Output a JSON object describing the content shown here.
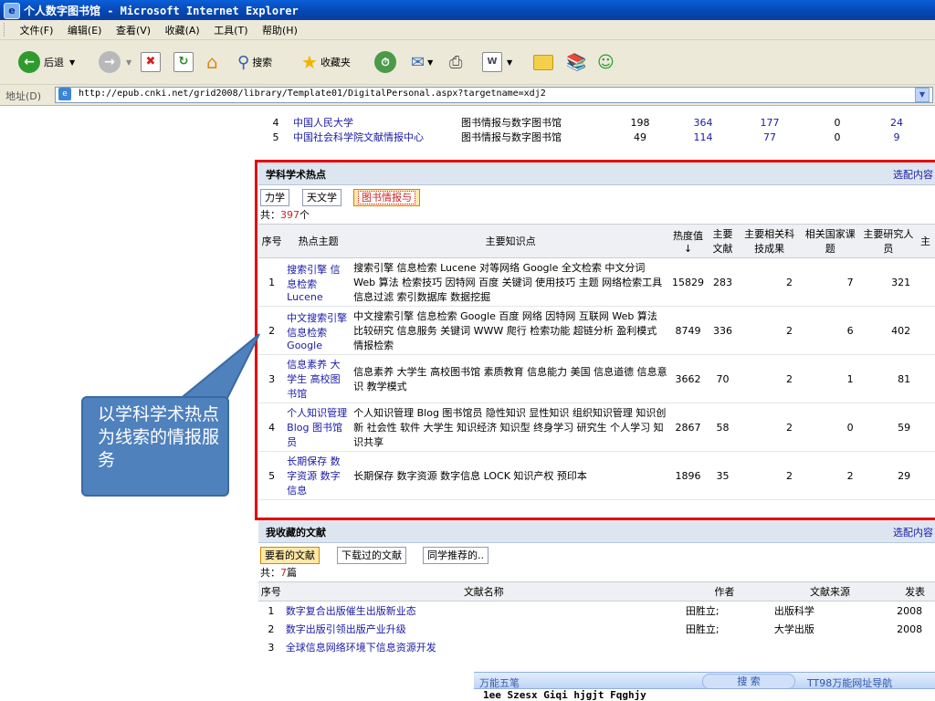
{
  "window": {
    "title": "个人数字图书馆 - Microsoft Internet Explorer"
  },
  "menu": [
    "文件(F)",
    "编辑(E)",
    "查看(V)",
    "收藏(A)",
    "工具(T)",
    "帮助(H)"
  ],
  "toolbar": {
    "back_label": "后退",
    "search_label": "搜索",
    "favorites_label": "收藏夹"
  },
  "address": {
    "label": "地址(D)",
    "url": "http://epub.cnki.net/grid2008/library/Template01/DigitalPersonal.aspx?targetname=xdj2"
  },
  "top_rows": [
    {
      "no": "4",
      "name": "中国人民大学",
      "subject": "图书情报与数字图书馆",
      "c1": "198",
      "c2": "364",
      "c3": "177",
      "c4": "0",
      "c5": "24"
    },
    {
      "no": "5",
      "name": "中国社会科学院文献情报中心",
      "subject": "图书情报与数字图书馆",
      "c1": "49",
      "c2": "114",
      "c3": "77",
      "c4": "0",
      "c5": "9"
    }
  ],
  "hot_panel": {
    "title": "学科学术热点",
    "options_label": "选配内容",
    "tabs": [
      "力学",
      "天文学",
      "图书情报与"
    ],
    "count_prefix": "共：",
    "count_value": "397",
    "count_suffix": "个",
    "headers": [
      "序号",
      "热点主题",
      "主要知识点",
      "热度值↓",
      "主要文献",
      "主要相关科技成果",
      "相关国家课题",
      "主要研究人员",
      "主"
    ],
    "rows": [
      {
        "no": "1",
        "topic": "搜索引擎 信息检索 Lucene",
        "points": "搜索引擎 信息检索 Lucene 对等网络 Google 全文检索 中文分词 Web 算法 检索技巧 因特网 百度 关键词 使用技巧 主题 网络检索工具 信息过滤 索引数据库 数据挖掘",
        "heat": "15829",
        "docs": "283",
        "achv": "2",
        "proj": "7",
        "people": "321"
      },
      {
        "no": "2",
        "topic": "中文搜索引擎 信息检索 Google",
        "points": "中文搜索引擎 信息检索 Google 百度 网络 因特网 互联网 Web 算法 比较研究 信息服务 关键词 WWW 爬行 检索功能 超链分析 盈利模式 情报检索",
        "heat": "8749",
        "docs": "336",
        "achv": "2",
        "proj": "6",
        "people": "402"
      },
      {
        "no": "3",
        "topic": "信息素养 大学生 高校图书馆",
        "points": "信息素养 大学生 高校图书馆 素质教育 信息能力 美国 信息道德 信息意识 教学模式",
        "heat": "3662",
        "docs": "70",
        "achv": "2",
        "proj": "1",
        "people": "81"
      },
      {
        "no": "4",
        "topic": "个人知识管理 Blog 图书馆员",
        "points": "个人知识管理 Blog 图书馆员 隐性知识 显性知识 组织知识管理 知识创新 社会性 软件 大学生 知识经济 知识型 终身学习 研究生 个人学习 知识共享",
        "heat": "2867",
        "docs": "58",
        "achv": "2",
        "proj": "0",
        "people": "59"
      },
      {
        "no": "5",
        "topic": "长期保存 数字资源 数字信息",
        "points": "长期保存 数字资源 数字信息 LOCK 知识产权 预印本",
        "heat": "1896",
        "docs": "35",
        "achv": "2",
        "proj": "2",
        "people": "29"
      }
    ]
  },
  "fav_panel": {
    "title": "我收藏的文献",
    "options_label": "选配内容",
    "tabs": [
      "要看的文献",
      "下载过的文献",
      "同学推荐的.."
    ],
    "count_prefix": "共：",
    "count_value": "7",
    "count_suffix": "篇",
    "headers": [
      "序号",
      "文献名称",
      "作者",
      "文献来源",
      "发表"
    ],
    "rows": [
      {
        "no": "1",
        "title": "数字复合出版催生出版新业态",
        "author": "田胜立;",
        "source": "出版科学",
        "year": "2008"
      },
      {
        "no": "2",
        "title": "数字出版引领出版产业升级",
        "author": "田胜立;",
        "source": "大学出版",
        "year": "2008"
      },
      {
        "no": "3",
        "title": "全球信息网络环境下信息资源开发",
        "author": "",
        "source": "",
        "year": ""
      }
    ]
  },
  "callout": {
    "text": "以学科学术热点为线索的情报服务"
  },
  "ime_bar": {
    "label1": "万能五笔",
    "search": "搜 索",
    "nav": "TT98万能网址导航",
    "line2": "1ee Szesx Giqi hjgjt Fqghjy"
  },
  "colors": {
    "title_bar": "#0646b0",
    "link": "#1a1aa6",
    "frame": "#e60000",
    "callout": "#4f81bd"
  }
}
